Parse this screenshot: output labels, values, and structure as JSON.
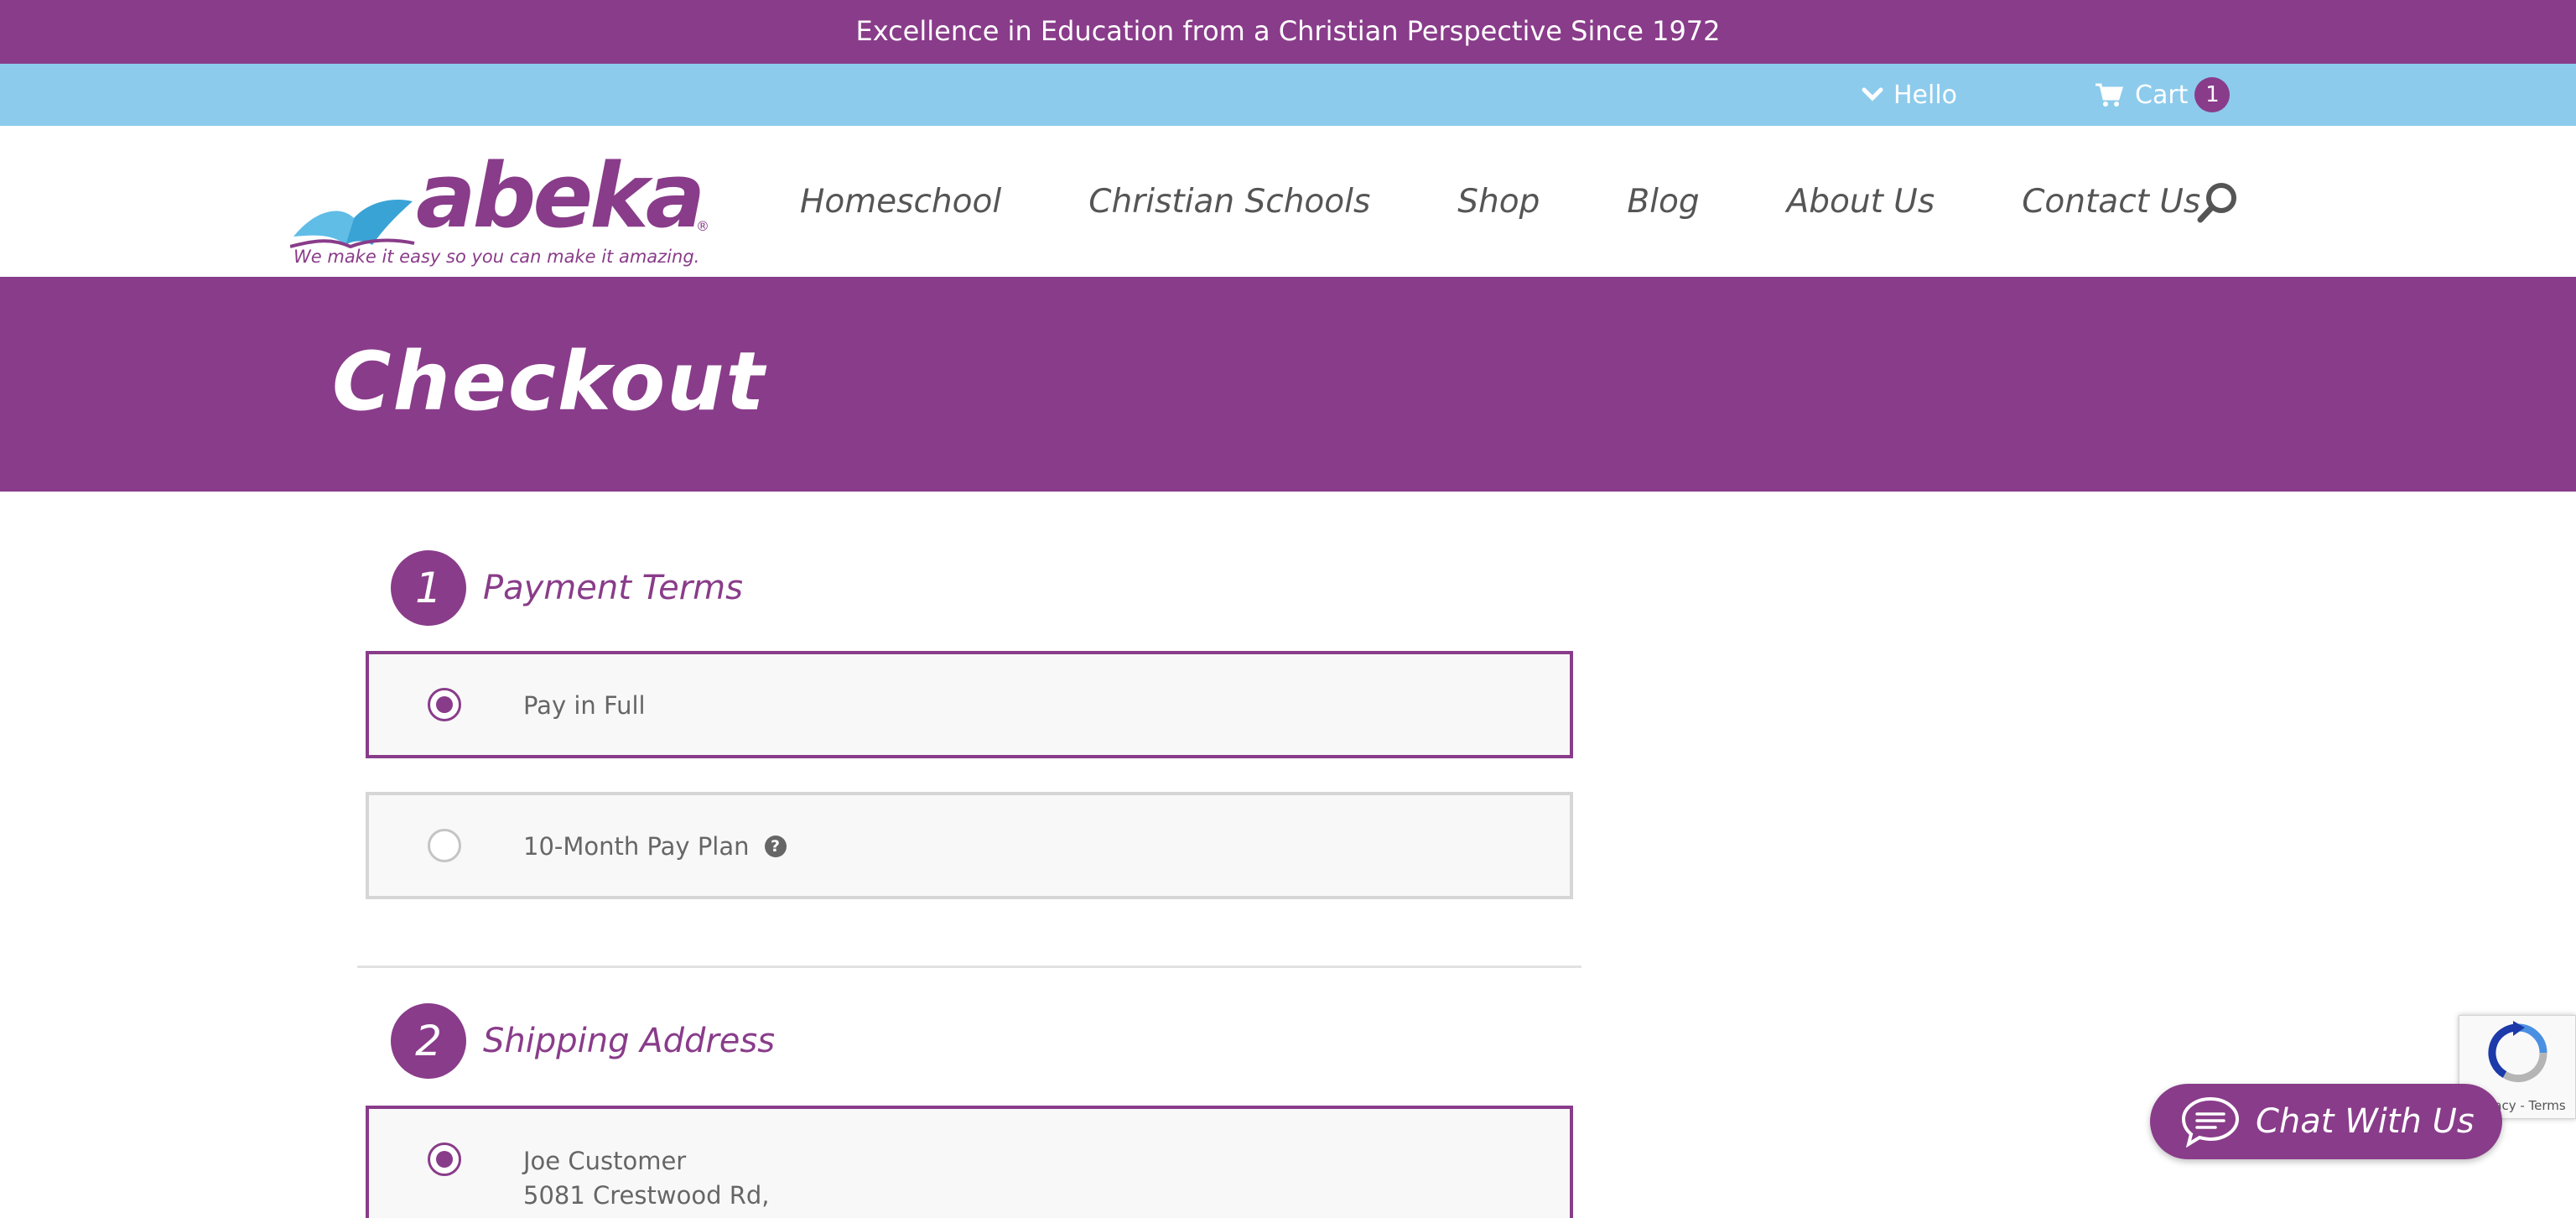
{
  "top_banner": {
    "text": "Excellence in Education from a Christian Perspective Since 1972"
  },
  "utility_bar": {
    "hello_label": "Hello",
    "cart_label": "Cart",
    "cart_count": "1"
  },
  "brand": {
    "logo_word": "abeka",
    "registered_mark": "®",
    "tagline": "We make it easy so you can make it amazing."
  },
  "nav": {
    "items": [
      "Homeschool",
      "Christian Schools",
      "Shop",
      "Blog",
      "About Us",
      "Contact Us"
    ]
  },
  "page": {
    "title": "Checkout"
  },
  "steps": [
    {
      "number": "1",
      "title": "Payment Terms",
      "options": [
        {
          "label": "Pay in Full",
          "selected": true
        },
        {
          "label": "10-Month Pay Plan",
          "selected": false,
          "help_icon": "question-circle-icon"
        }
      ]
    },
    {
      "number": "2",
      "title": "Shipping Address",
      "address": {
        "selected": true,
        "name": "Joe Customer",
        "street": "5081 Crestwood Rd,"
      }
    }
  ],
  "recaptcha": {
    "links": "Privacy - Terms"
  },
  "chat": {
    "label": "Chat With Us"
  },
  "colors": {
    "brand_purple": "#893c8a",
    "light_blue": "#8ccbec",
    "option_bg": "#f8f8f8"
  }
}
